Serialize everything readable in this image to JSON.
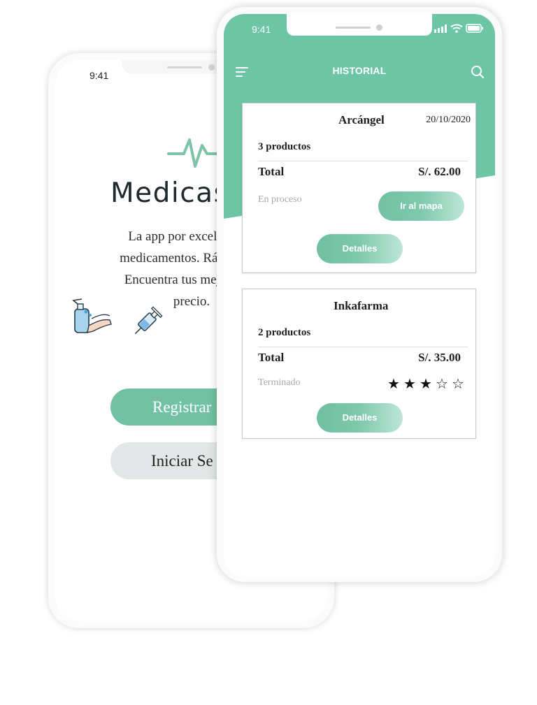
{
  "back_phone": {
    "time": "9:41",
    "brand": "Medicas",
    "intro_lines": [
      "La app por excelencia p",
      "medicamentos. Rápida, efe",
      "Encuentra tus mejores op",
      "precio."
    ],
    "register_label": "Registrar",
    "login_label": "Iniciar Se",
    "accent_color": "#72c1a4"
  },
  "front_phone": {
    "time": "9:41",
    "header_title": "HISTORIAL",
    "icons": [
      "menu-icon",
      "search-icon",
      "signal-icon",
      "wifi-icon",
      "battery-icon"
    ],
    "accent_color": "#6cc5a5",
    "orders": [
      {
        "store": "Arcángel",
        "date": "20/10/2020",
        "products": "3 productos",
        "total_label": "Total",
        "total_value": "S/. 62.00",
        "status": "En proceso",
        "map_label": "Ir al mapa",
        "details_label": "Detalles"
      },
      {
        "store": "Inkafarma",
        "products": "2 productos",
        "total_label": "Total",
        "total_value": "S/. 35.00",
        "status": "Terminado",
        "rating": 3,
        "rating_max": 5,
        "details_label": "Detalles"
      }
    ]
  }
}
